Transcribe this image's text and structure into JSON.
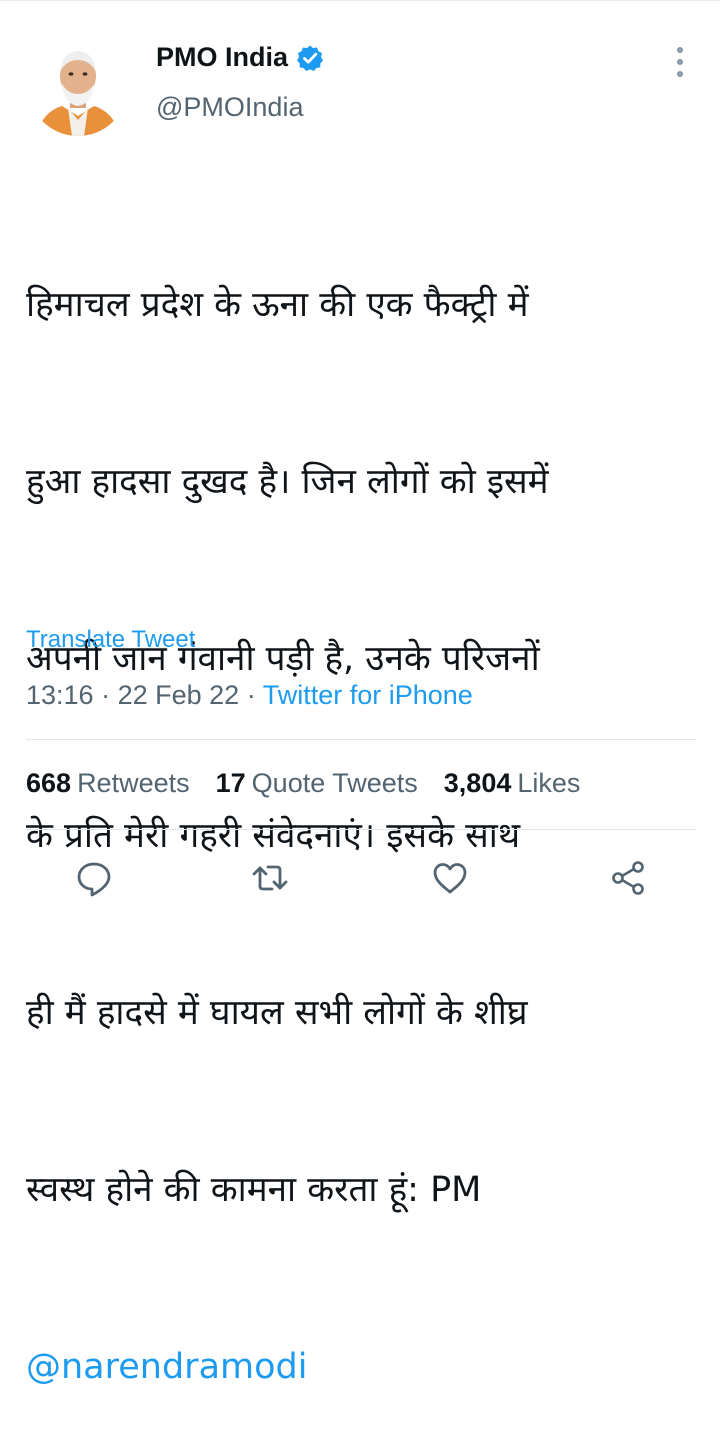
{
  "tweet": {
    "author_name": "PMO India",
    "handle": "@PMOIndia",
    "text_lines": [
      "हिमाचल प्रदेश के ऊना की एक फैक्ट्री में",
      "हुआ हादसा दुखद है। जिन लोगों को इसमें",
      "अपनी जान गंवानी पड़ी है, उनके परिजनों",
      "के प्रति मेरी गहरी संवेदनाएं। इसके साथ",
      "ही मैं हादसे में घायल सभी लोगों के शीघ्र",
      "स्वस्थ होने की कामना करता हूं: PM"
    ],
    "mention": "@narendramodi",
    "translate_label": "Translate Tweet",
    "time": "13:16",
    "date": "22 Feb 22",
    "separator": "·",
    "source": "Twitter for iPhone"
  },
  "stats": {
    "retweets_count": "668",
    "retweets_label": "Retweets",
    "quotes_count": "17",
    "quotes_label": "Quote Tweets",
    "likes_count": "3,804",
    "likes_label": "Likes"
  },
  "icons": {
    "verified": "verified-badge-icon",
    "more": "more-vertical-icon",
    "reply": "reply-icon",
    "retweet": "retweet-icon",
    "like": "heart-icon",
    "share": "share-icon"
  },
  "colors": {
    "accent": "#1d9bf0",
    "text": "#0f1419",
    "secondary": "#536471"
  }
}
